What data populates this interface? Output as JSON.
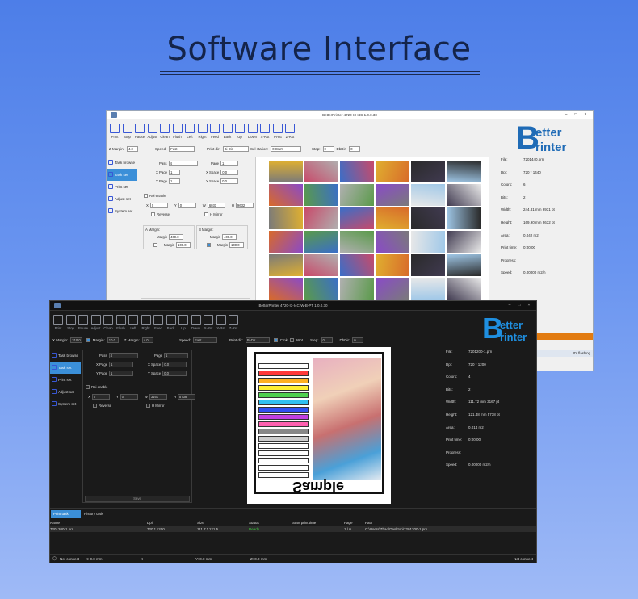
{
  "heading": "Software Interface",
  "light": {
    "title": "BetterPrinter 4720-I3-I4C 1.0.0.30",
    "toolbar": [
      "Print",
      "Stop",
      "Pause",
      "Adjust",
      "Clean",
      "Flush",
      "Left",
      "Right",
      "Feed",
      "Back",
      "Up",
      "Down",
      "X-Rst",
      "Y-Rst",
      "Z-Rst"
    ],
    "opts": {
      "zmargin_label": "Z Margin:",
      "zmargin_val": "4.0",
      "speed_label": "Speed:",
      "speed_val": "Fast",
      "printdir_label": "Print dir:",
      "printdir_val": "Bi-Dir",
      "selstation_label": "Sel station:",
      "selstation_val": "0 Start",
      "step_label": "Step:",
      "step_val": "0",
      "dbdir_label": "DbDir:",
      "dbdir_val": "0"
    },
    "sidebar": [
      "Task browse",
      "Task set",
      "Print set",
      "Adjust set",
      "System set"
    ],
    "form": {
      "pass_label": "Pass",
      "pass_val": "4",
      "page_label": "Page",
      "page_val": "1",
      "xpage_label": "X Page",
      "xpage_val": "1",
      "xspace_label": "X Space",
      "xspace_val": "0.0",
      "ypage_label": "Y Page",
      "ypage_val": "1",
      "yspace_label": "Y Space",
      "yspace_val": "0.0",
      "roi": "Roi enable",
      "x": "X",
      "x_val": "0",
      "y": "Y",
      "y_val": "0",
      "w": "W",
      "w_val": "6031",
      "h": "H",
      "h_val": "9632",
      "reverse": "Reverse",
      "hmirror": "H Mirror",
      "amargin": "A Margin:",
      "bmargin": "B Margin:",
      "margin1": "Margin",
      "margin1_val": "400.0",
      "margin2": "Margin",
      "margin2_val": "100.0",
      "margin3": "Margin",
      "margin3_val": "400.0",
      "margin4": "Margin",
      "margin4_val": "100.0"
    },
    "info": [
      {
        "k": "File:",
        "v": "7201440.prn"
      },
      {
        "k": "Dpi:",
        "v": "720 * 1440"
      },
      {
        "k": "Colors:",
        "v": "6"
      },
      {
        "k": "Bits:",
        "v": "2"
      },
      {
        "k": "Width:",
        "v": "244.81 mm   6931 pt"
      },
      {
        "k": "Height:",
        "v": "169.90 mm   9632 pt"
      },
      {
        "k": "Area:",
        "v": "0.042 m2"
      },
      {
        "k": "Print time:",
        "v": "0:00:00"
      },
      {
        "k": "Progress:",
        "v": ""
      },
      {
        "k": "Speed:",
        "v": "0.00000 m2/h"
      }
    ],
    "taskbar_text": "It's flashing"
  },
  "dark": {
    "title": "BetterPrinter 4720-I3-I4C-W-B-PT 1.0.0.30",
    "toolbar": [
      "Print",
      "Stop",
      "Pause",
      "Adjust",
      "Clean",
      "Flush",
      "Left",
      "Right",
      "Feed",
      "Back",
      "Up",
      "Down",
      "X-Rst",
      "Y-Rst",
      "Z-Rst"
    ],
    "opts": {
      "xmargin_label": "X Margin:",
      "xmargin_val": "310.0",
      "ymargin_label": "Margin:",
      "ymargin_val": "10.0",
      "zmargin_label": "Z Margin:",
      "zmargin_val": "4.0",
      "speed_label": "Speed:",
      "speed_val": "Fast",
      "printdir_label": "Print dir:",
      "printdir_val": "Bi-Dir",
      "cmk": "Cmk",
      "wht": "Wht",
      "step_label": "Step:",
      "step_val": "0",
      "dbdir_label": "DbDir:",
      "dbdir_val": "0"
    },
    "sidebar": [
      "Task browse",
      "Task set",
      "Print set",
      "Adjust set",
      "System set"
    ],
    "form": {
      "pass_label": "Pass",
      "pass_val": "4",
      "page_label": "Page",
      "page_val": "1",
      "xpage_label": "X Page",
      "xpage_val": "1",
      "xspace_label": "X Space",
      "xspace_val": "0.0",
      "ypage_label": "Y Page",
      "ypage_val": "1",
      "yspace_label": "Y Space",
      "yspace_val": "0.0",
      "roi": "Roi enable",
      "x": "X",
      "x_val": "0",
      "y": "Y",
      "y_val": "0",
      "w": "W",
      "w_val": "3161",
      "h": "H",
      "h_val": "5738",
      "reverse": "Reverse",
      "hmirror": "H Mirror",
      "save": "Save"
    },
    "info": [
      {
        "k": "File:",
        "v": "7201200-1.prn"
      },
      {
        "k": "Dpi:",
        "v": "720 * 1200"
      },
      {
        "k": "Colors:",
        "v": "4"
      },
      {
        "k": "Bits:",
        "v": "2"
      },
      {
        "k": "Width:",
        "v": "111.72 mm   3167 pt"
      },
      {
        "k": "Height:",
        "v": "121.48 mm   5738 pt"
      },
      {
        "k": "Area:",
        "v": "0.014 m2"
      },
      {
        "k": "Print time:",
        "v": "0:00:00"
      },
      {
        "k": "Progress:",
        "v": ""
      },
      {
        "k": "Speed:",
        "v": "0.00000 m2/h"
      }
    ],
    "tabs": [
      "Print task",
      "History task"
    ],
    "table": {
      "headers": [
        "Name",
        "Dpi",
        "Size",
        "Status",
        "Start print time",
        "Page",
        "Path"
      ],
      "rows": [
        [
          "7201200-1.prn",
          "720 * 1200",
          "111.7 * 121.5",
          "Ready",
          "",
          "1 / 0",
          "C:\\Users\\Zhao\\Desktop\\7201200-1.prn"
        ]
      ]
    },
    "status": {
      "conn": "Not connect",
      "x": "X: 0.0 mm",
      "x2": "X",
      "y": "Y: 0.0 mm",
      "z": "Z: 0.0 mm",
      "conn2": "Not connect"
    },
    "preview_text": "Sample"
  }
}
